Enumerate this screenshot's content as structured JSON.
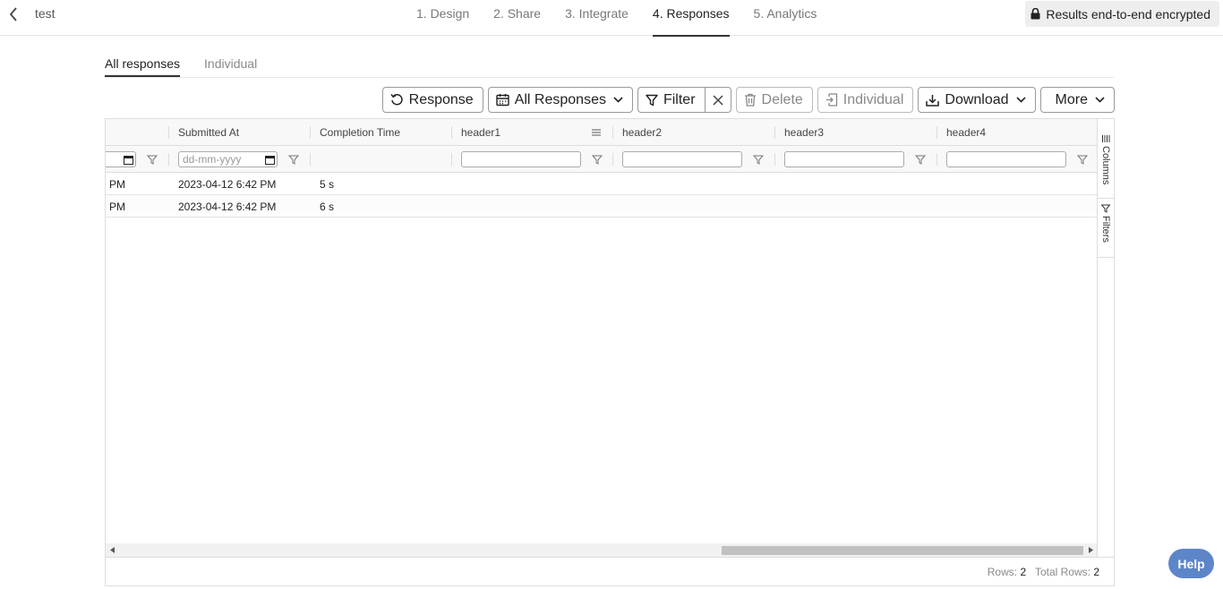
{
  "header": {
    "form_name": "test",
    "steps": [
      {
        "label": "1. Design"
      },
      {
        "label": "2. Share"
      },
      {
        "label": "3. Integrate"
      },
      {
        "label": "4. Responses",
        "active": true
      },
      {
        "label": "5. Analytics"
      }
    ],
    "encryption_badge": "Results end-to-end encrypted"
  },
  "subtabs": [
    {
      "label": "All responses",
      "active": true
    },
    {
      "label": "Individual"
    }
  ],
  "toolbar": {
    "response": "Response",
    "range": "All Responses",
    "filter": "Filter",
    "delete": "Delete",
    "individual": "Individual",
    "download": "Download",
    "more": "More"
  },
  "grid": {
    "columns": [
      "",
      "Submitted At",
      "Completion Time",
      "header1",
      "header2",
      "header3",
      "header4"
    ],
    "date_placeholder": "dd-mm-yyyy",
    "rows": [
      [
        "PM",
        "2023-04-12 6:42 PM",
        "5 s"
      ],
      [
        "PM",
        "2023-04-12 6:42 PM",
        "6 s"
      ]
    ],
    "side_panels": [
      "Columns",
      "Filters"
    ],
    "status": {
      "rows_label": "Rows:",
      "rows_value": "2",
      "total_label": "Total Rows:",
      "total_value": "2"
    }
  },
  "help_label": "Help",
  "colors": {
    "help": "#5d86c8",
    "active_underline": "#333333"
  }
}
